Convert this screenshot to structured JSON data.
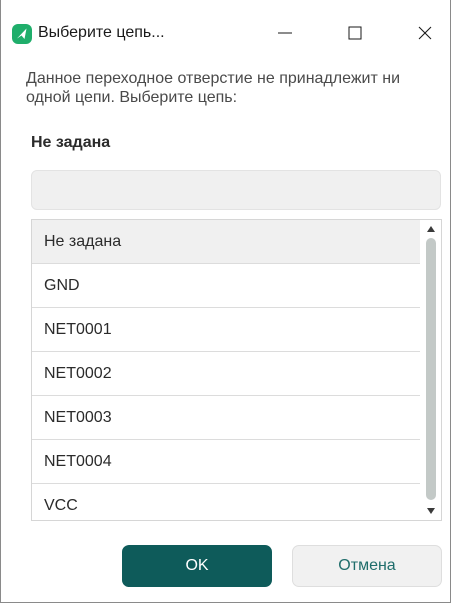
{
  "window": {
    "title": "Выберите цепь...",
    "minimize_label": "Minimize",
    "maximize_label": "Maximize",
    "close_label": "Close"
  },
  "dialog": {
    "message": "Данное переходное отверстие не принадлежит ни одной цепи. Выберите цепь:",
    "current_net": "Не задана",
    "search": {
      "value": "",
      "placeholder": ""
    },
    "nets": [
      {
        "label": "Не задана",
        "selected": true
      },
      {
        "label": "GND",
        "selected": false
      },
      {
        "label": "NET0001",
        "selected": false
      },
      {
        "label": "NET0002",
        "selected": false
      },
      {
        "label": "NET0003",
        "selected": false
      },
      {
        "label": "NET0004",
        "selected": false
      },
      {
        "label": "VCC",
        "selected": false
      }
    ],
    "ok_label": "OK",
    "cancel_label": "Отмена"
  },
  "icons": {
    "app": "app-logo-icon",
    "minimize": "minimize-icon",
    "maximize": "maximize-icon",
    "close": "close-icon",
    "scroll_up": "scroll-up-arrow-icon",
    "scroll_down": "scroll-down-arrow-icon"
  },
  "colors": {
    "accent": "#0e5b5a",
    "accent_text": "#1f6d6b",
    "selected_row": "#f0f0f0",
    "logo_green": "#1fae6b"
  }
}
